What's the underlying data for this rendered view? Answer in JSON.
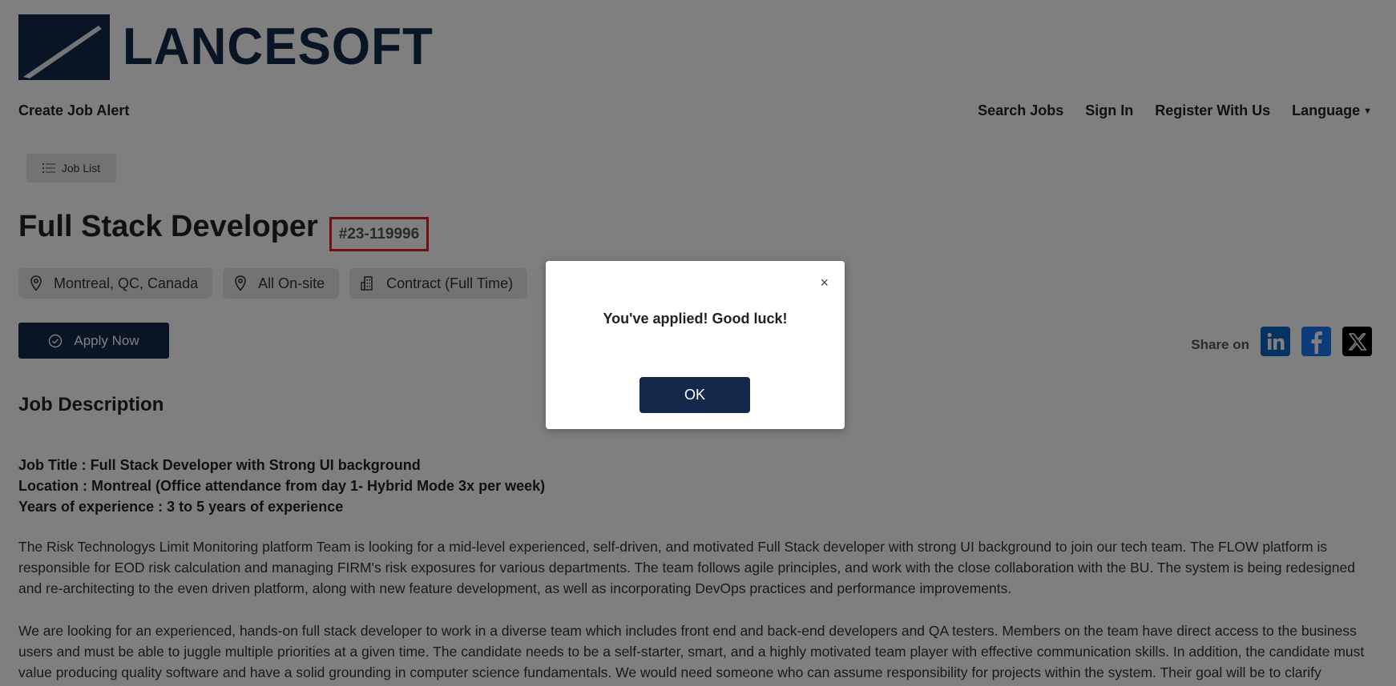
{
  "brand": {
    "name": "LANCESOFT",
    "color": "#13284a"
  },
  "nav": {
    "left": "Create Job Alert",
    "right": [
      "Search Jobs",
      "Sign In",
      "Register With Us",
      "Language"
    ]
  },
  "job_list_button": {
    "label": "Job List",
    "icon": "list-icon"
  },
  "job": {
    "title": "Full Stack Developer",
    "id": "#23-119996",
    "tags": [
      {
        "icon": "location-pin-icon",
        "label": "Montreal, QC, Canada"
      },
      {
        "icon": "location-pin-icon",
        "label": "All On-site"
      },
      {
        "icon": "building-icon",
        "label": "Contract (Full Time)"
      }
    ],
    "apply_label": "Apply Now"
  },
  "share": {
    "label": "Share on",
    "networks": [
      "linkedin-icon",
      "facebook-icon",
      "x-icon"
    ]
  },
  "description": {
    "heading": "Job Description",
    "meta": [
      "Job Title : Full Stack Developer with Strong UI background",
      "Location : Montreal (Office attendance from day 1- Hybrid Mode 3x per week)",
      "Years of experience : 3 to 5 years of experience"
    ],
    "paragraphs": [
      "The Risk Technologys Limit Monitoring platform Team is looking for a mid-level experienced, self-driven, and motivated Full Stack developer with strong UI background to join our tech team. The FLOW platform is responsible for EOD risk calculation and managing FIRM's risk exposures for various departments. The team follows agile principles, and work with the close collaboration with the BU. The system is being redesigned and re-architecting to the even driven platform, along with new feature development, as well as incorporating DevOps practices and performance improvements.",
      "We are looking for an experienced, hands-on full stack developer to work in a diverse team which includes front end and back-end developers and QA testers. Members on the team have direct access to the business users and must be able to juggle multiple priorities at a given time. The candidate needs to be a self-starter, smart, and a highly motivated team player with effective communication skills. In addition, the candidate must value producing quality software and have a solid grounding in computer science fundamentals. We would need someone who can assume responsibility for projects within the system. Their goal will be to clarify"
    ]
  },
  "modal": {
    "close": "×",
    "message": "You've applied! Good luck!",
    "ok_label": "OK"
  }
}
